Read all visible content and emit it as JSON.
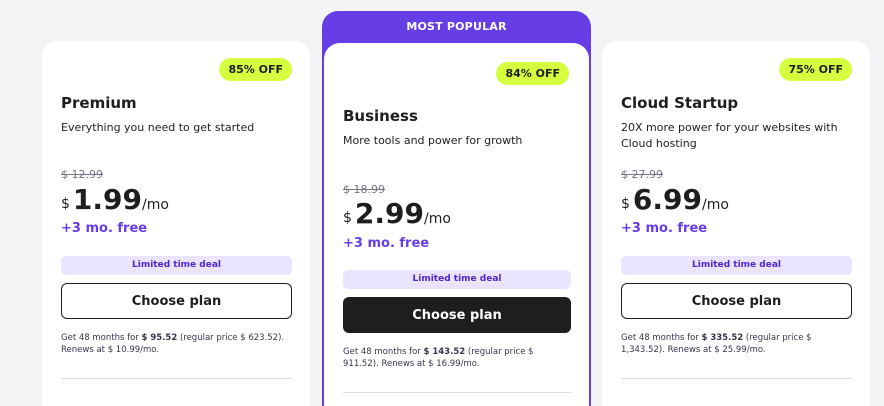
{
  "popular_label": "MOST POPULAR",
  "plans": [
    {
      "badge": "85% OFF",
      "name": "Premium",
      "description": "Everything you need to get started",
      "old_price": "$ 12.99",
      "currency": "$",
      "price": "1.99",
      "period": "/mo",
      "free": "+3 mo. free",
      "deal": "Limited time deal",
      "button": "Choose plan",
      "terms_prefix": "Get 48 months for ",
      "terms_total": "$ 95.52",
      "terms_suffix": " (regular price $ 623.52). Renews at $ 10.99/mo."
    },
    {
      "badge": "84% OFF",
      "name": "Business",
      "description": "More tools and power for growth",
      "old_price": "$ 18.99",
      "currency": "$",
      "price": "2.99",
      "period": "/mo",
      "free": "+3 mo. free",
      "deal": "Limited time deal",
      "button": "Choose plan",
      "terms_prefix": "Get 48 months for ",
      "terms_total": "$ 143.52",
      "terms_suffix": " (regular price $ 911.52). Renews at $ 16.99/mo."
    },
    {
      "badge": "75% OFF",
      "name": "Cloud Startup",
      "description": "20X more power for your websites with Cloud hosting",
      "old_price": "$ 27.99",
      "currency": "$",
      "price": "6.99",
      "period": "/mo",
      "free": "+3 mo. free",
      "deal": "Limited time deal",
      "button": "Choose plan",
      "terms_prefix": "Get 48 months for ",
      "terms_total": "$ 335.52",
      "terms_suffix": " (regular price $ 1,343.52). Renews at $ 25.99/mo."
    }
  ],
  "colors": {
    "accent": "#673de6",
    "badge": "#d5ff3e",
    "deal_bg": "#ebe4ff",
    "primary_button": "#1d1e20"
  }
}
